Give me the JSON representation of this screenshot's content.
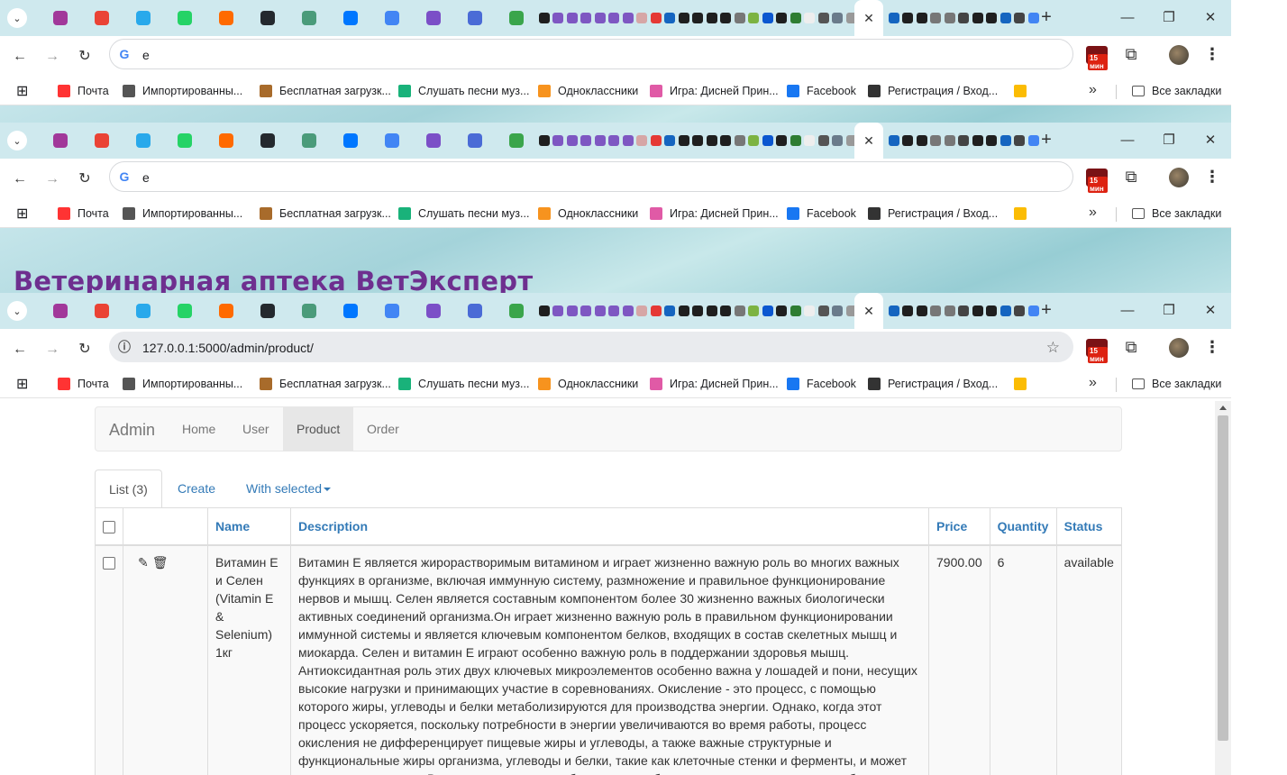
{
  "browser": {
    "tab_strip": {
      "close_glyph": "✕",
      "new_tab_glyph": "+",
      "pinned": [
        {
          "icon": "wildberries-icon",
          "color": "#a1389a"
        },
        {
          "icon": "gmail-icon",
          "color": "#ea4335"
        },
        {
          "icon": "telegram-icon",
          "color": "#29a9eb"
        },
        {
          "icon": "whatsapp-icon",
          "color": "#25d366"
        },
        {
          "icon": "kinopoisk-icon",
          "color": "#ff6a00"
        },
        {
          "icon": "github-icon",
          "color": "#24292e"
        },
        {
          "icon": "robot-icon",
          "color": "#4a9b7a"
        },
        {
          "icon": "vk-icon",
          "color": "#0077ff"
        },
        {
          "icon": "sparkle-icon",
          "color": "#4285f4"
        },
        {
          "icon": "flower-icon",
          "color": "#7b4fc7"
        },
        {
          "icon": "sparkle-icon",
          "color": "#4a6bd6"
        },
        {
          "icon": "puzzle-ext-icon",
          "color": "#3aa54b"
        }
      ],
      "mini_colors": [
        "#1f1f1f",
        "#7e57c2",
        "#7e57c2",
        "#7e57c2",
        "#7e57c2",
        "#7e57c2",
        "#7e57c2",
        "#d6a6a6",
        "#e53935",
        "#1565c0",
        "#1f1f1f",
        "#1f1f1f",
        "#1f1f1f",
        "#1f1f1f",
        "#777777",
        "#7cb342",
        "#0b57d0",
        "#1f1f1f",
        "#2e7d32",
        "#eeeeee",
        "#555555",
        "#6a7b8b",
        "#999999",
        "#1f1f1f"
      ],
      "mini_colors_right": [
        "#1565c0",
        "#1f1f1f",
        "#1f1f1f",
        "#777777",
        "#777777",
        "#444444",
        "#1f1f1f",
        "#1f1f1f",
        "#1565c0",
        "#444444",
        "#4285f4"
      ]
    },
    "windows": [
      {
        "url": "e",
        "has_star": false
      },
      {
        "url": "e",
        "has_star": false
      },
      {
        "url": "127.0.0.1:5000/admin/product/",
        "has_star": true
      }
    ],
    "extension_badge": "15 мин",
    "bookmarks": [
      {
        "label": "Почта",
        "icon": "yandex-icon",
        "color": "#f33"
      },
      {
        "label": "Импортированны...",
        "icon": "folder-icon",
        "color": "#555"
      },
      {
        "label": "Бесплатная загрузк...",
        "icon": "image-icon",
        "color": "#a86b2b"
      },
      {
        "label": "Слушать песни муз...",
        "icon": "play-icon",
        "color": "#19b27a"
      },
      {
        "label": "Одноклассники",
        "icon": "ok-icon",
        "color": "#f7931e"
      },
      {
        "label": "Игра: Дисней Прин...",
        "icon": "heart-icon",
        "color": "#e05aa6"
      },
      {
        "label": "Facebook",
        "icon": "facebook-icon",
        "color": "#1877f2"
      },
      {
        "label": "Регистрация / Вход...",
        "icon": "globe-icon",
        "color": "#333"
      },
      {
        "label": "",
        "icon": "drive-icon",
        "color": "#fbbc04"
      }
    ],
    "all_bookmarks": "Все закладки"
  },
  "site_title": "Ветеринарная аптека ВетЭксперт",
  "admin": {
    "brand": "Admin",
    "nav": [
      "Home",
      "User",
      "Product",
      "Order"
    ],
    "active_nav": "Product",
    "tabs": {
      "list": "List (3)",
      "create": "Create",
      "with_selected": "With selected"
    },
    "columns": {
      "name": "Name",
      "description": "Description",
      "price": "Price",
      "quantity": "Quantity",
      "status": "Status"
    },
    "rows": [
      {
        "name": "Витамин Е и Селен (Vitamin E & Selenium) 1кг",
        "description": "Витамин Е является жирорастворимым витамином и играет жизненно важную роль во многих важных функциях в организме, включая иммунную систему, размножение и правильное функционирование нервов и мышц. Селен является составным компонентом более 30 жизненно важных биологически активных соединений организма.Он играет жизненно важную роль в правильном функционировании иммунной системы и является ключевым компонентом белков, входящих в состав скелетных мышц и миокарда. Селен и витамин Е играют особенно важную роль в поддержании здоровья мышц. Антиоксидантная роль этих двух ключевых микроэлементов особенно важна у лошадей и пони, несущих высокие нагрузки и принимающих участие в соревнованиях. Окисление - это процесс, с помощью которого жиры, углеводы и белки метаболизируются для производства энергии. Однако, когда этот процесс ускоряется, поскольку потребности в энергии увеличиваются во время работы, процесс окисления не дифференцирует пищевые жиры и углеводы, а также важные структурные и функциональные жиры организма, углеводы и белки, такие как клеточные стенки и ферменты, и может начать разрушать их. В процессе окисления образуются свободные радикалы и другие нестабильные",
        "price": "7900.00",
        "quantity": "6",
        "status": "available"
      }
    ]
  }
}
